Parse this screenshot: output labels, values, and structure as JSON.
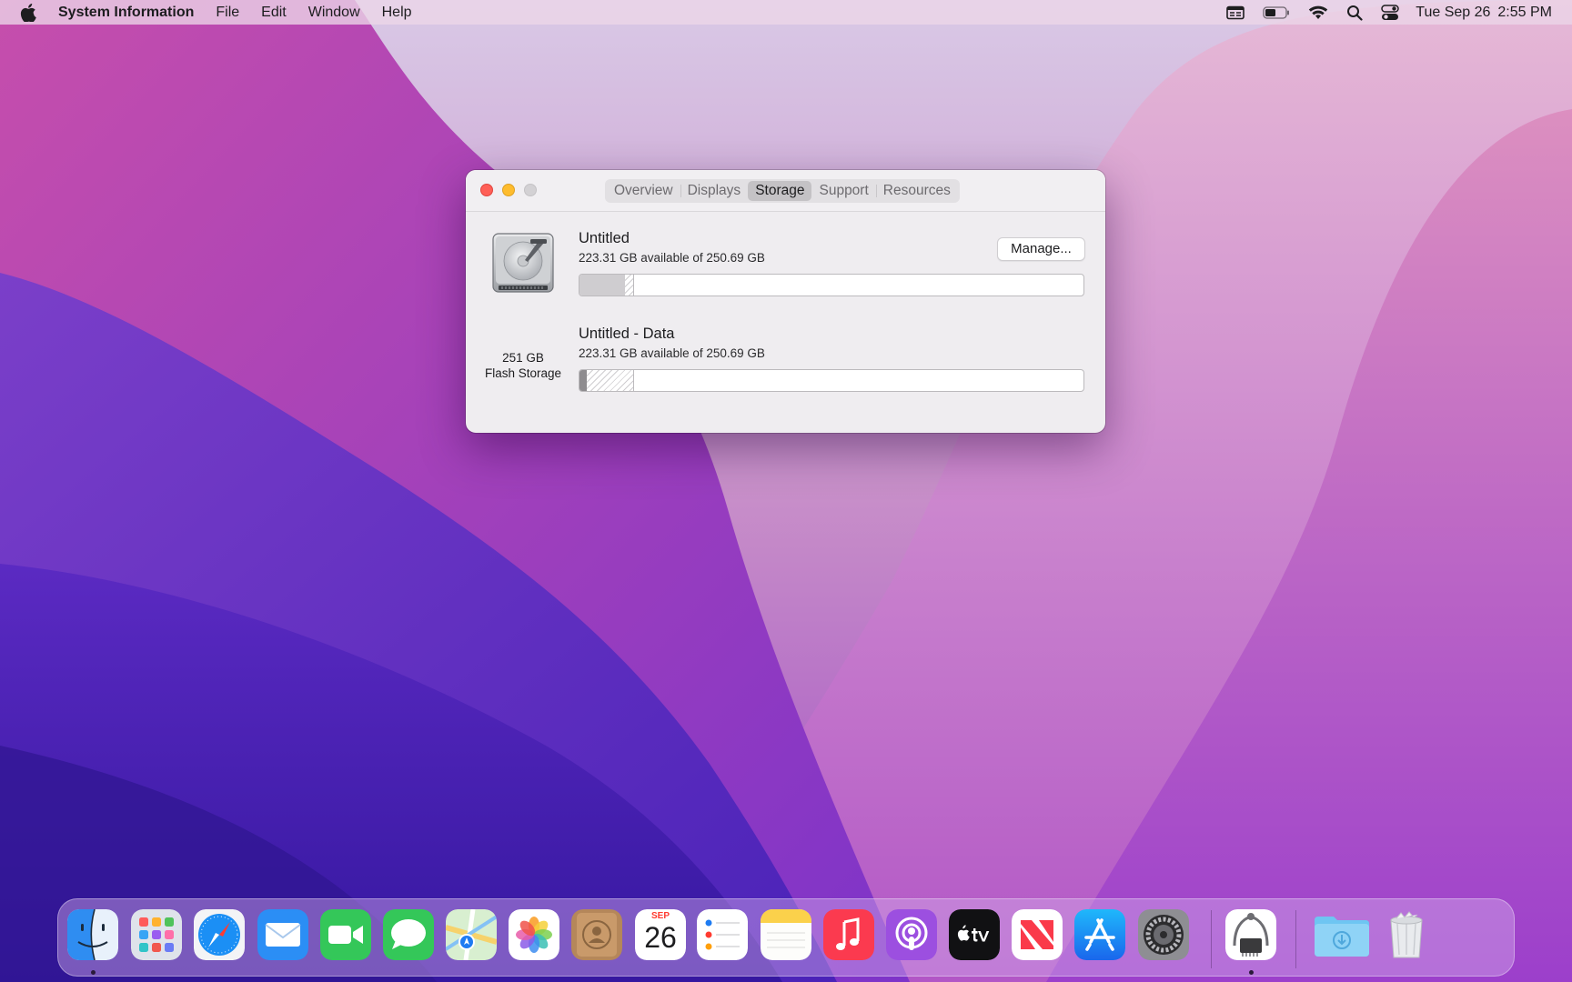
{
  "menubar": {
    "app_name": "System Information",
    "menus": [
      "File",
      "Edit",
      "Window",
      "Help"
    ],
    "clock_date": "Tue Sep 26",
    "clock_time": "2:55 PM",
    "status_icons": [
      "keyboard-input-icon",
      "battery-icon",
      "wifi-icon",
      "spotlight-search-icon",
      "control-center-icon"
    ]
  },
  "window": {
    "tabs": [
      "Overview",
      "Displays",
      "Storage",
      "Support",
      "Resources"
    ],
    "active_tab": "Storage",
    "disk": {
      "capacity": "251 GB",
      "type": "Flash Storage"
    },
    "manage_label": "Manage...",
    "volumes": [
      {
        "name": "Untitled",
        "availability": "223.31 GB available of 250.69 GB",
        "used_fraction": 0.09,
        "other_fraction": 0.019
      },
      {
        "name": "Untitled - Data",
        "availability": "223.31 GB available of 250.69 GB",
        "used_fraction": 0.014,
        "other_fraction": 0.095
      }
    ]
  },
  "dock": {
    "calendar_month": "SEP",
    "calendar_day": "26",
    "apps": [
      "Finder",
      "Launchpad",
      "Safari",
      "Mail",
      "FaceTime",
      "Messages",
      "Maps",
      "Photos",
      "Contacts",
      "Calendar",
      "Reminders",
      "Notes",
      "Music",
      "Podcasts",
      "TV",
      "News",
      "App Store",
      "System Settings",
      "System Information",
      "Downloads",
      "Trash"
    ]
  },
  "colors": {
    "close": "#ff5f57",
    "minimize": "#febc2e",
    "zoom_disabled": "#d3d1d4",
    "accent_blue": "#1e7cf2"
  }
}
